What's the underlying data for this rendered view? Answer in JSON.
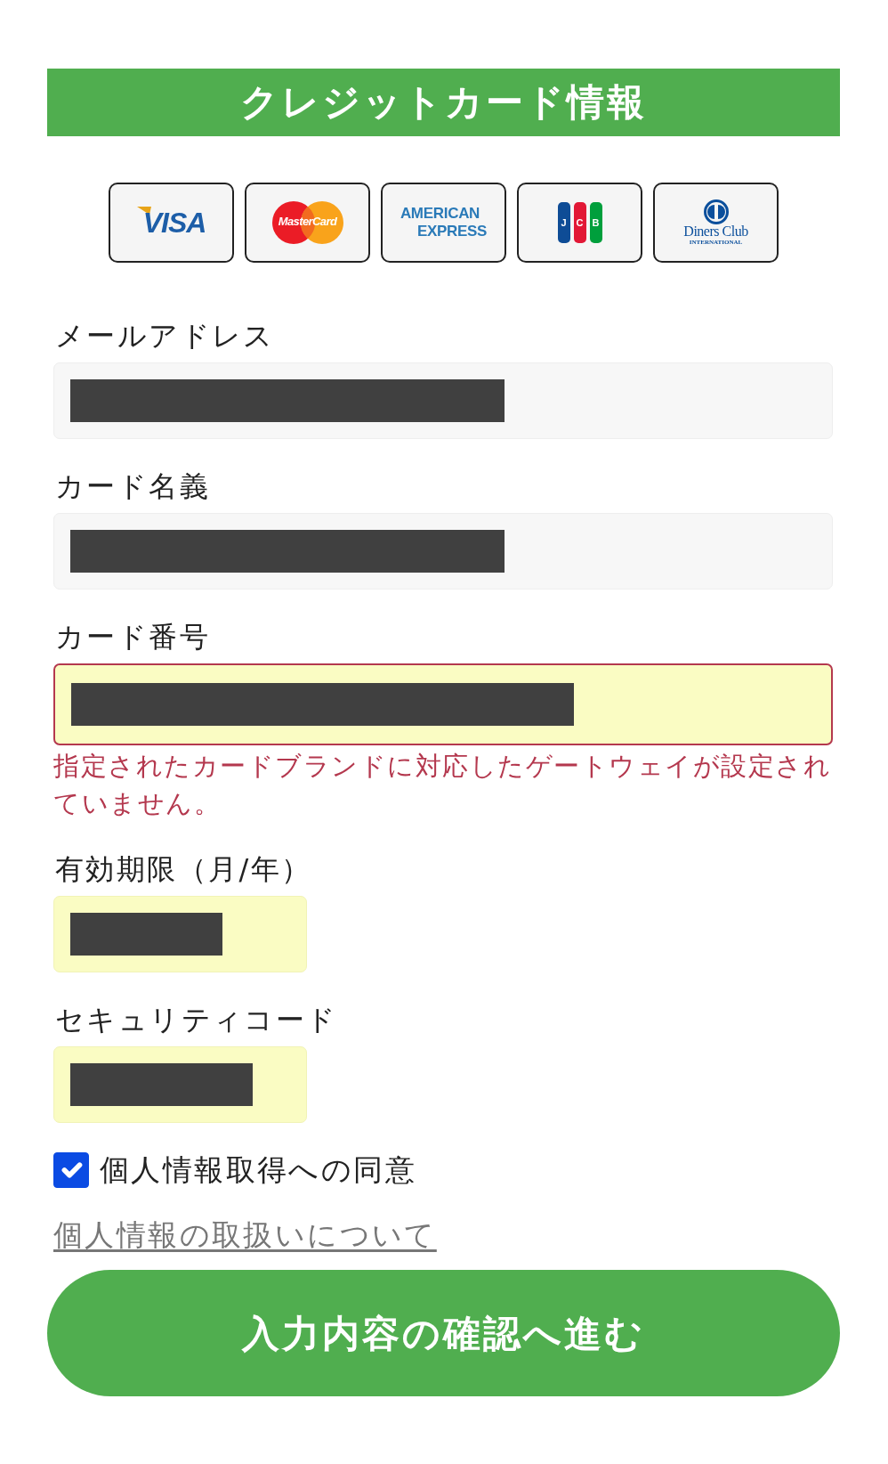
{
  "header": {
    "title": "クレジットカード情報"
  },
  "card_brands": [
    {
      "kind": "visa",
      "texts": [
        "VISA"
      ]
    },
    {
      "kind": "mastercard",
      "texts": [
        "MasterCard"
      ]
    },
    {
      "kind": "amex",
      "texts": [
        "AMERICAN",
        "EXPRESS"
      ]
    },
    {
      "kind": "jcb",
      "texts": [
        "J",
        "C",
        "B"
      ]
    },
    {
      "kind": "diners",
      "texts": [
        "Diners Club",
        "INTERNATIONAL"
      ]
    }
  ],
  "fields": [
    {
      "kind": "email",
      "label": "メールアドレス",
      "redacted": true,
      "autofilled": false,
      "invalid": false
    },
    {
      "kind": "name",
      "label": "カード名義",
      "redacted": true,
      "autofilled": false,
      "invalid": false
    },
    {
      "kind": "number",
      "label": "カード番号",
      "redacted": true,
      "autofilled": true,
      "invalid": true,
      "error": "指定されたカードブランドに対応したゲートウェイが設定されていません。"
    },
    {
      "kind": "expiry",
      "label": "有効期限（月/年）",
      "redacted": true,
      "autofilled": true,
      "invalid": false
    },
    {
      "kind": "code",
      "label": "セキュリティコード",
      "redacted": true,
      "autofilled": true,
      "invalid": false
    }
  ],
  "consent": {
    "label": "個人情報取得への同意",
    "checked": true
  },
  "privacy_link": {
    "text": "個人情報の取扱いについて"
  },
  "submit_button": {
    "label": "入力内容の確認へ進む"
  }
}
